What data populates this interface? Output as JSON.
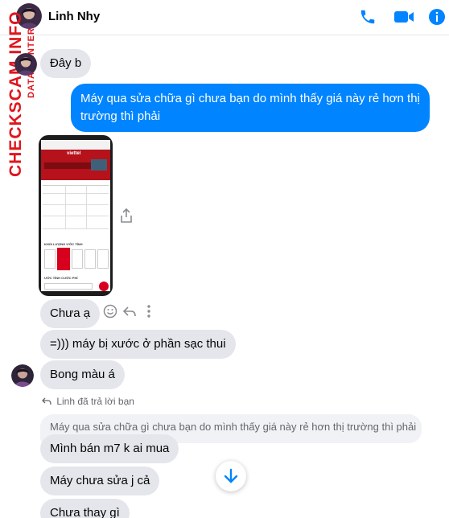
{
  "header": {
    "contact_name": "Linh Nhy"
  },
  "watermark": {
    "site": "CHECKSCAM.INFO",
    "sub": "DATA CENTER"
  },
  "messages": {
    "m1": "Đây b",
    "m2": "Máy qua sửa chữa gì chưa bạn do mình thấy giá này rẻ hơn thị trường thì phải",
    "m3": "Chưa ạ",
    "m4": "=))) máy bị xước ở phần sạc thui",
    "m5": "Bong màu á",
    "reply_note": "Linh đã trả lời bạn",
    "quoted": "Máy qua sửa chữa gì chưa bạn do mình thấy giá này rẻ hơn thị trường thì phải",
    "m6": "Mình bán m7 k ai mua",
    "m7": "Máy chưa sửa j cả",
    "m8": "Chưa thay gì"
  },
  "screenshot": {
    "brand": "viettel",
    "section1": "KHỐI LƯỢNG ƯỚC TÍNH",
    "section2": "ƯỚC TÍNH CƯỚC PHÍ"
  },
  "colors": {
    "accent": "#0084ff",
    "bubble_gray": "#e4e6eb",
    "watermark": "#e0161d",
    "viettel_red": "#d7001e"
  }
}
